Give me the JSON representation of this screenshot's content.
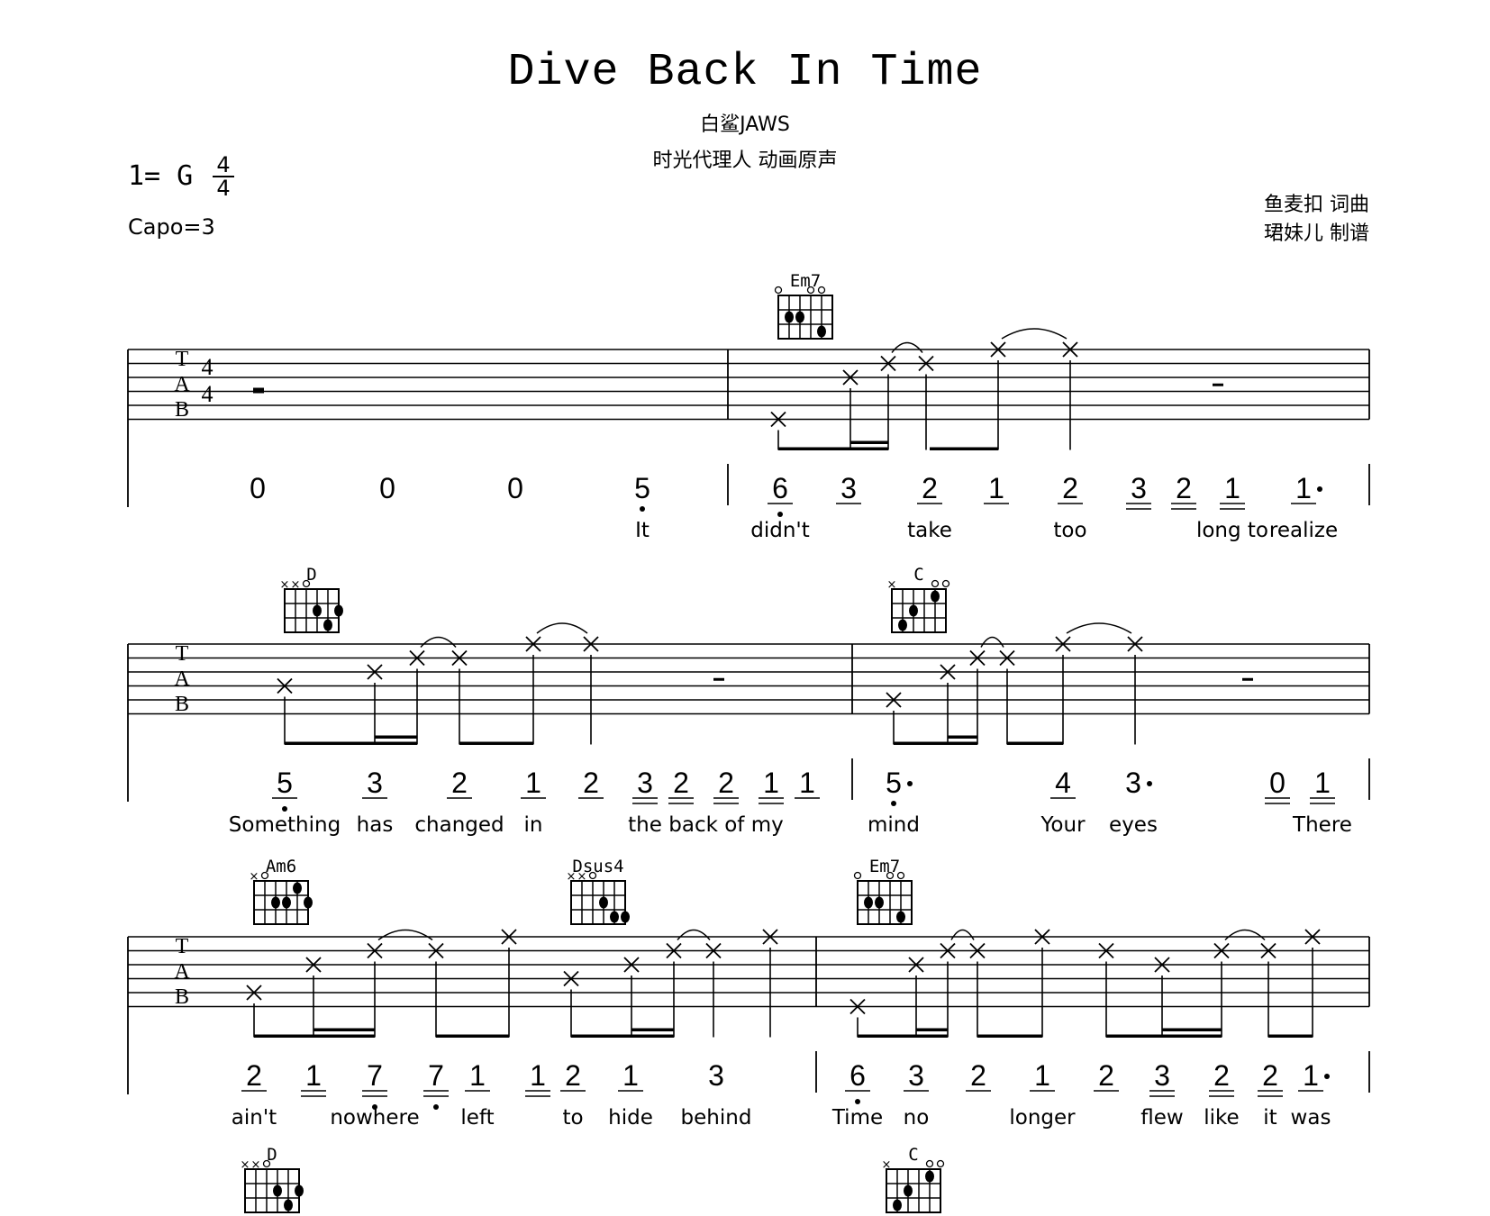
{
  "header": {
    "title": "Dive Back In Time",
    "artist": "白鲨JAWS",
    "source": "时光代理人 动画原声",
    "key": "1= G",
    "time_signature": {
      "top": "4",
      "bottom": "4"
    },
    "capo": "Capo=3",
    "credits": [
      "鱼麦扣 词曲",
      "珺妹儿 制谱"
    ]
  },
  "tab_clef": [
    "T",
    "A",
    "B"
  ],
  "systems": [
    {
      "measures": [
        {
          "chords": [],
          "tab_time_sig": [
            "4",
            "4"
          ],
          "rest": "whole",
          "notes": [
            {
              "n": "0"
            },
            {
              "n": "0"
            },
            {
              "n": "0"
            },
            {
              "n": "5",
              "dot_below": true,
              "lyric": "It"
            }
          ]
        },
        {
          "chords": [
            {
              "name": "Em7",
              "top": [
                "o",
                "",
                "",
                "o",
                "o",
                ""
              ],
              "dots": [
                [
                  1,
                  2
                ],
                [
                  2,
                  2
                ],
                [
                  4,
                  3
                ]
              ]
            }
          ],
          "rest": "half",
          "notes": [
            {
              "n": "6",
              "dot_below": true,
              "u": 1,
              "lyric": "didn't"
            },
            {
              "n": "3",
              "u": 1
            },
            {
              "n": "2",
              "u": 1,
              "lyric": "take"
            },
            {
              "n": "1",
              "u": 1
            },
            {
              "n": "2",
              "u": 1,
              "lyric": "too"
            },
            {
              "n": "3",
              "u": 2
            },
            {
              "n": "2",
              "u": 2
            },
            {
              "n": "1",
              "u": 2,
              "lyric": "long to"
            },
            {
              "n": "1",
              "dotted": true,
              "u": 1,
              "lyric": "realize"
            }
          ]
        }
      ]
    },
    {
      "measures": [
        {
          "chords": [
            {
              "name": "D",
              "top": [
                "x",
                "x",
                "o",
                "",
                "",
                ""
              ],
              "dots": [
                [
                  3,
                  2
                ],
                [
                  5,
                  2
                ],
                [
                  4,
                  3
                ]
              ]
            }
          ],
          "rest": "half",
          "notes": [
            {
              "n": "5",
              "dot_below": true,
              "u": 1,
              "lyric": "Something"
            },
            {
              "n": "3",
              "u": 1,
              "lyric": "has"
            },
            {
              "n": "2",
              "u": 1,
              "lyric": "changed"
            },
            {
              "n": "1",
              "u": 1,
              "lyric": "in"
            },
            {
              "n": "2",
              "u": 1
            },
            {
              "n": "3",
              "u": 2,
              "lyric": "the"
            },
            {
              "n": "2",
              "u": 2
            },
            {
              "n": "2",
              "u": 2,
              "lyric": "back of my"
            },
            {
              "n": "1",
              "u": 2
            },
            {
              "n": "1",
              "u": 1
            }
          ]
        },
        {
          "chords": [
            {
              "name": "C",
              "top": [
                "x",
                "",
                "",
                "",
                "o",
                "o"
              ],
              "dots": [
                [
                  1,
                  3
                ],
                [
                  2,
                  2
                ],
                [
                  4,
                  1
                ]
              ]
            }
          ],
          "rest": "half",
          "notes": [
            {
              "n": "5",
              "dot_below": true,
              "dotted": true,
              "lyric": "mind"
            },
            {
              "n": "4",
              "u": 1,
              "lyric": "Your"
            },
            {
              "n": "3",
              "dotted": true,
              "lyric": "eyes"
            },
            {
              "n": "0",
              "u": 2
            },
            {
              "n": "1",
              "u": 2,
              "lyric": "There"
            }
          ]
        }
      ]
    },
    {
      "measures": [
        {
          "chords": [
            {
              "name": "Am6",
              "top": [
                "x",
                "o",
                "",
                "",
                "",
                ""
              ],
              "dots": [
                [
                  2,
                  2
                ],
                [
                  3,
                  2
                ],
                [
                  4,
                  1
                ],
                [
                  5,
                  2
                ]
              ]
            },
            {
              "name": "Dsus4",
              "top": [
                "x",
                "x",
                "o",
                "",
                "",
                ""
              ],
              "dots": [
                [
                  3,
                  2
                ],
                [
                  4,
                  3
                ],
                [
                  5,
                  3
                ]
              ]
            }
          ],
          "notes": [
            {
              "n": "2",
              "u": 1,
              "lyric": "ain't"
            },
            {
              "n": "1",
              "u": 2
            },
            {
              "n": "7",
              "u": 2,
              "dot_below": true,
              "lyric": "nowhere"
            },
            {
              "n": "7",
              "u": 2,
              "dot_below": true
            },
            {
              "n": "1",
              "u": 1,
              "lyric": "left"
            },
            {
              "n": "1",
              "u": 2
            },
            {
              "n": "2",
              "u": 1,
              "lyric": "to"
            },
            {
              "n": "1",
              "u": 1,
              "lyric": "hide"
            },
            {
              "n": "3",
              "lyric": "behind"
            }
          ]
        },
        {
          "chords": [
            {
              "name": "Em7",
              "top": [
                "o",
                "",
                "",
                "o",
                "o",
                ""
              ],
              "dots": [
                [
                  1,
                  2
                ],
                [
                  2,
                  2
                ],
                [
                  4,
                  3
                ]
              ]
            }
          ],
          "notes": [
            {
              "n": "6",
              "dot_below": true,
              "u": 1,
              "lyric": "Time"
            },
            {
              "n": "3",
              "u": 1,
              "lyric": "no"
            },
            {
              "n": "2",
              "u": 1
            },
            {
              "n": "1",
              "u": 1,
              "lyric": "longer"
            },
            {
              "n": "2",
              "u": 1
            },
            {
              "n": "3",
              "u": 2,
              "lyric": "flew"
            },
            {
              "n": "2",
              "u": 2,
              "lyric": "like"
            },
            {
              "n": "2",
              "u": 2,
              "lyric": "it"
            },
            {
              "n": "1",
              "dotted": true,
              "u": 1,
              "lyric": "was"
            }
          ]
        }
      ]
    },
    {
      "measures": [
        {
          "chords": [
            {
              "name": "D",
              "top": [
                "x",
                "x",
                "o",
                "",
                "",
                ""
              ],
              "dots": [
                [
                  3,
                  2
                ],
                [
                  5,
                  2
                ],
                [
                  4,
                  3
                ]
              ]
            }
          ]
        },
        {
          "chords": [
            {
              "name": "C",
              "top": [
                "x",
                "",
                "",
                "",
                "o",
                "o"
              ],
              "dots": [
                [
                  1,
                  3
                ],
                [
                  2,
                  2
                ],
                [
                  4,
                  1
                ]
              ]
            }
          ]
        }
      ]
    }
  ]
}
